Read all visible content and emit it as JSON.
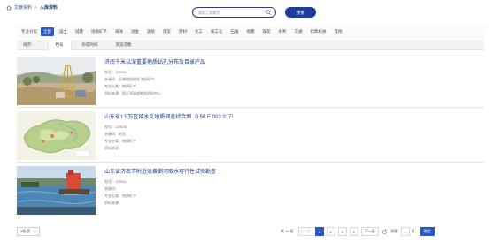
{
  "breadcrumb": {
    "items": [
      "文献资料",
      "入库资料"
    ],
    "separator": ">"
  },
  "search": {
    "placeholder": "请输入关键字",
    "button_label": "搜索"
  },
  "categories": {
    "label": "专业分类",
    "items": [
      "全部",
      "国土",
      "城建",
      "地质矿产",
      "海洋",
      "冶金",
      "测绘",
      "煤炭",
      "建材",
      "化工",
      "核工业",
      "石油",
      "地震",
      "煤炭",
      "水利",
      "交通",
      "行政机关",
      "其他"
    ],
    "active_index": 0
  },
  "sort": {
    "label": "排序：",
    "items": [
      "档号",
      "形成时间",
      "浏览次数"
    ],
    "active_index": 0
  },
  "results": [
    {
      "title": "济南千米以深重要地质钻孔分布及目录产品",
      "fields": [
        {
          "label": "档号：",
          "value": "125201"
        },
        {
          "label": "关键词：",
          "value": "区域地质地质 地质矿产"
        },
        {
          "label": "专业分类：",
          "value": "地质矿产"
        },
        {
          "label": "资料来源：",
          "value": "国土资源部地质资料中心"
        }
      ]
    },
    {
      "title": "山东省1:5万区域水文地质调查综合图（I 50 E 003 017）",
      "fields": [
        {
          "label": "档号：",
          "value": "125535"
        },
        {
          "label": "关键词：",
          "value": "地质"
        },
        {
          "label": "专业分类：",
          "value": "地质矿产"
        },
        {
          "label": "资料来源：",
          "value": ""
        }
      ]
    },
    {
      "title": "山东省济南市附近沿黄倒河取水可行性试验勘查",
      "fields": [
        {
          "label": "档号：",
          "value": "125532"
        },
        {
          "label": "关键词：",
          "value": ""
        },
        {
          "label": "专业分类：",
          "value": "地质矿产"
        },
        {
          "label": "资料来源：",
          "value": ""
        }
      ]
    }
  ],
  "pagination": {
    "per_page": "3条/页",
    "total_text": "共 19 条",
    "prev_label": "上一页",
    "pages": [
      "1",
      "2",
      "3",
      "4"
    ],
    "current_page": "1",
    "next_label": "下一页",
    "goto_label": "到第",
    "goto_value": "1",
    "page_suffix": "页",
    "confirm_label": "确定"
  },
  "colors": {
    "accent": "#2a58c9",
    "title_link": "#1f3a8a",
    "search_border": "#1e3e9a"
  },
  "icons": {
    "home": "home-icon",
    "search": "search-icon",
    "caret": "chevron-down-icon"
  }
}
